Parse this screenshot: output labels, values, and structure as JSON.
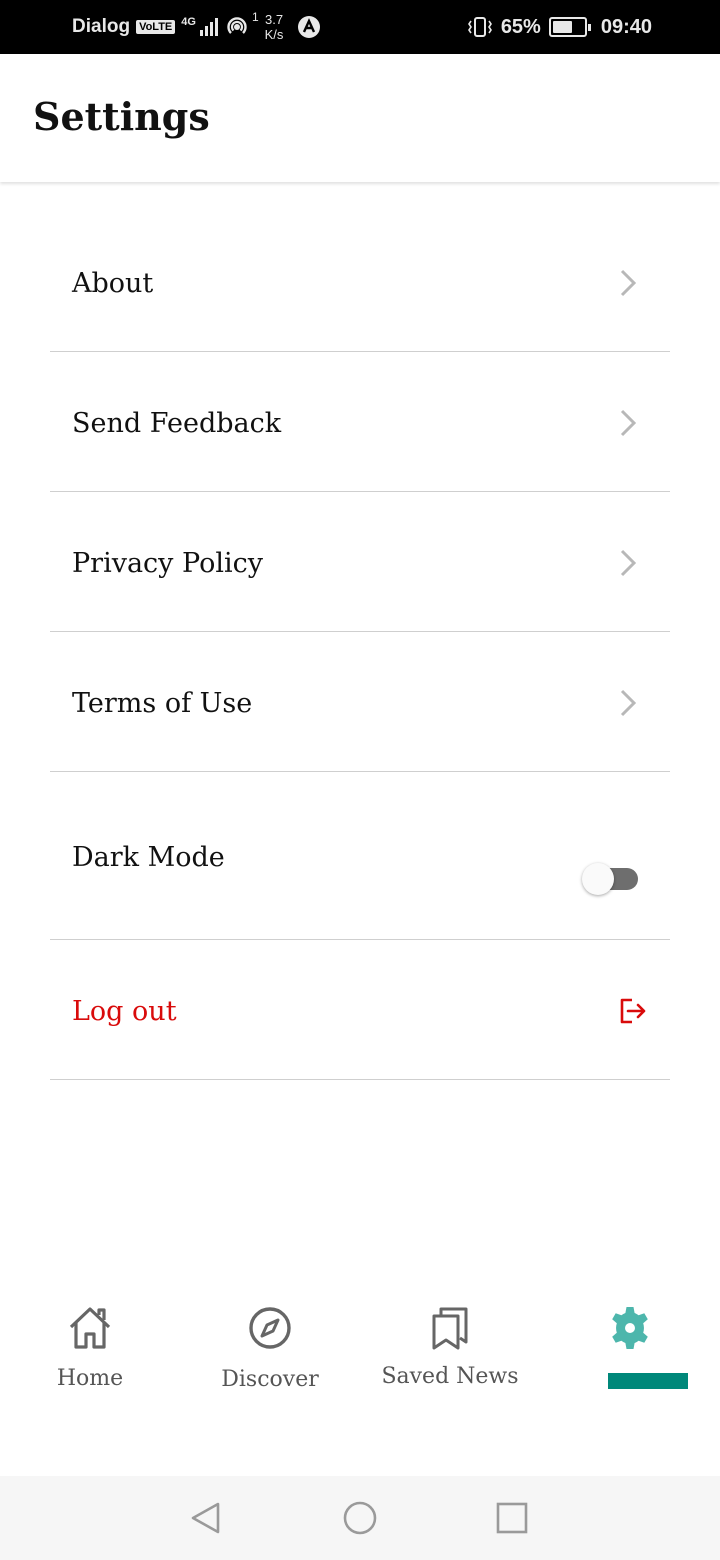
{
  "status_bar": {
    "carrier": "Dialog",
    "volte_badge": "VoLTE",
    "network": "4G",
    "hotspot_count": "1",
    "speed_value": "3.7",
    "speed_unit": "K/s",
    "battery_percent": "65%",
    "battery_level": 0.65,
    "time": "09:40"
  },
  "header": {
    "title": "Settings"
  },
  "settings": {
    "items": [
      {
        "label": "About"
      },
      {
        "label": "Send Feedback"
      },
      {
        "label": "Privacy Policy"
      },
      {
        "label": "Terms of Use"
      }
    ],
    "dark_mode": {
      "label": "Dark Mode",
      "enabled": false
    },
    "logout": {
      "label": "Log out",
      "color": "#d90b0b"
    }
  },
  "bottom_nav": {
    "items": [
      {
        "label": "Home",
        "icon": "home-icon"
      },
      {
        "label": "Discover",
        "icon": "compass-icon"
      },
      {
        "label": "Saved News",
        "icon": "bookmarks-icon"
      },
      {
        "label": "",
        "icon": "gear-icon",
        "active": true
      }
    ],
    "active_color": "#4db6ac",
    "indicator_color": "#00887a"
  },
  "system_nav": {
    "buttons": [
      "back",
      "home",
      "recents"
    ]
  }
}
